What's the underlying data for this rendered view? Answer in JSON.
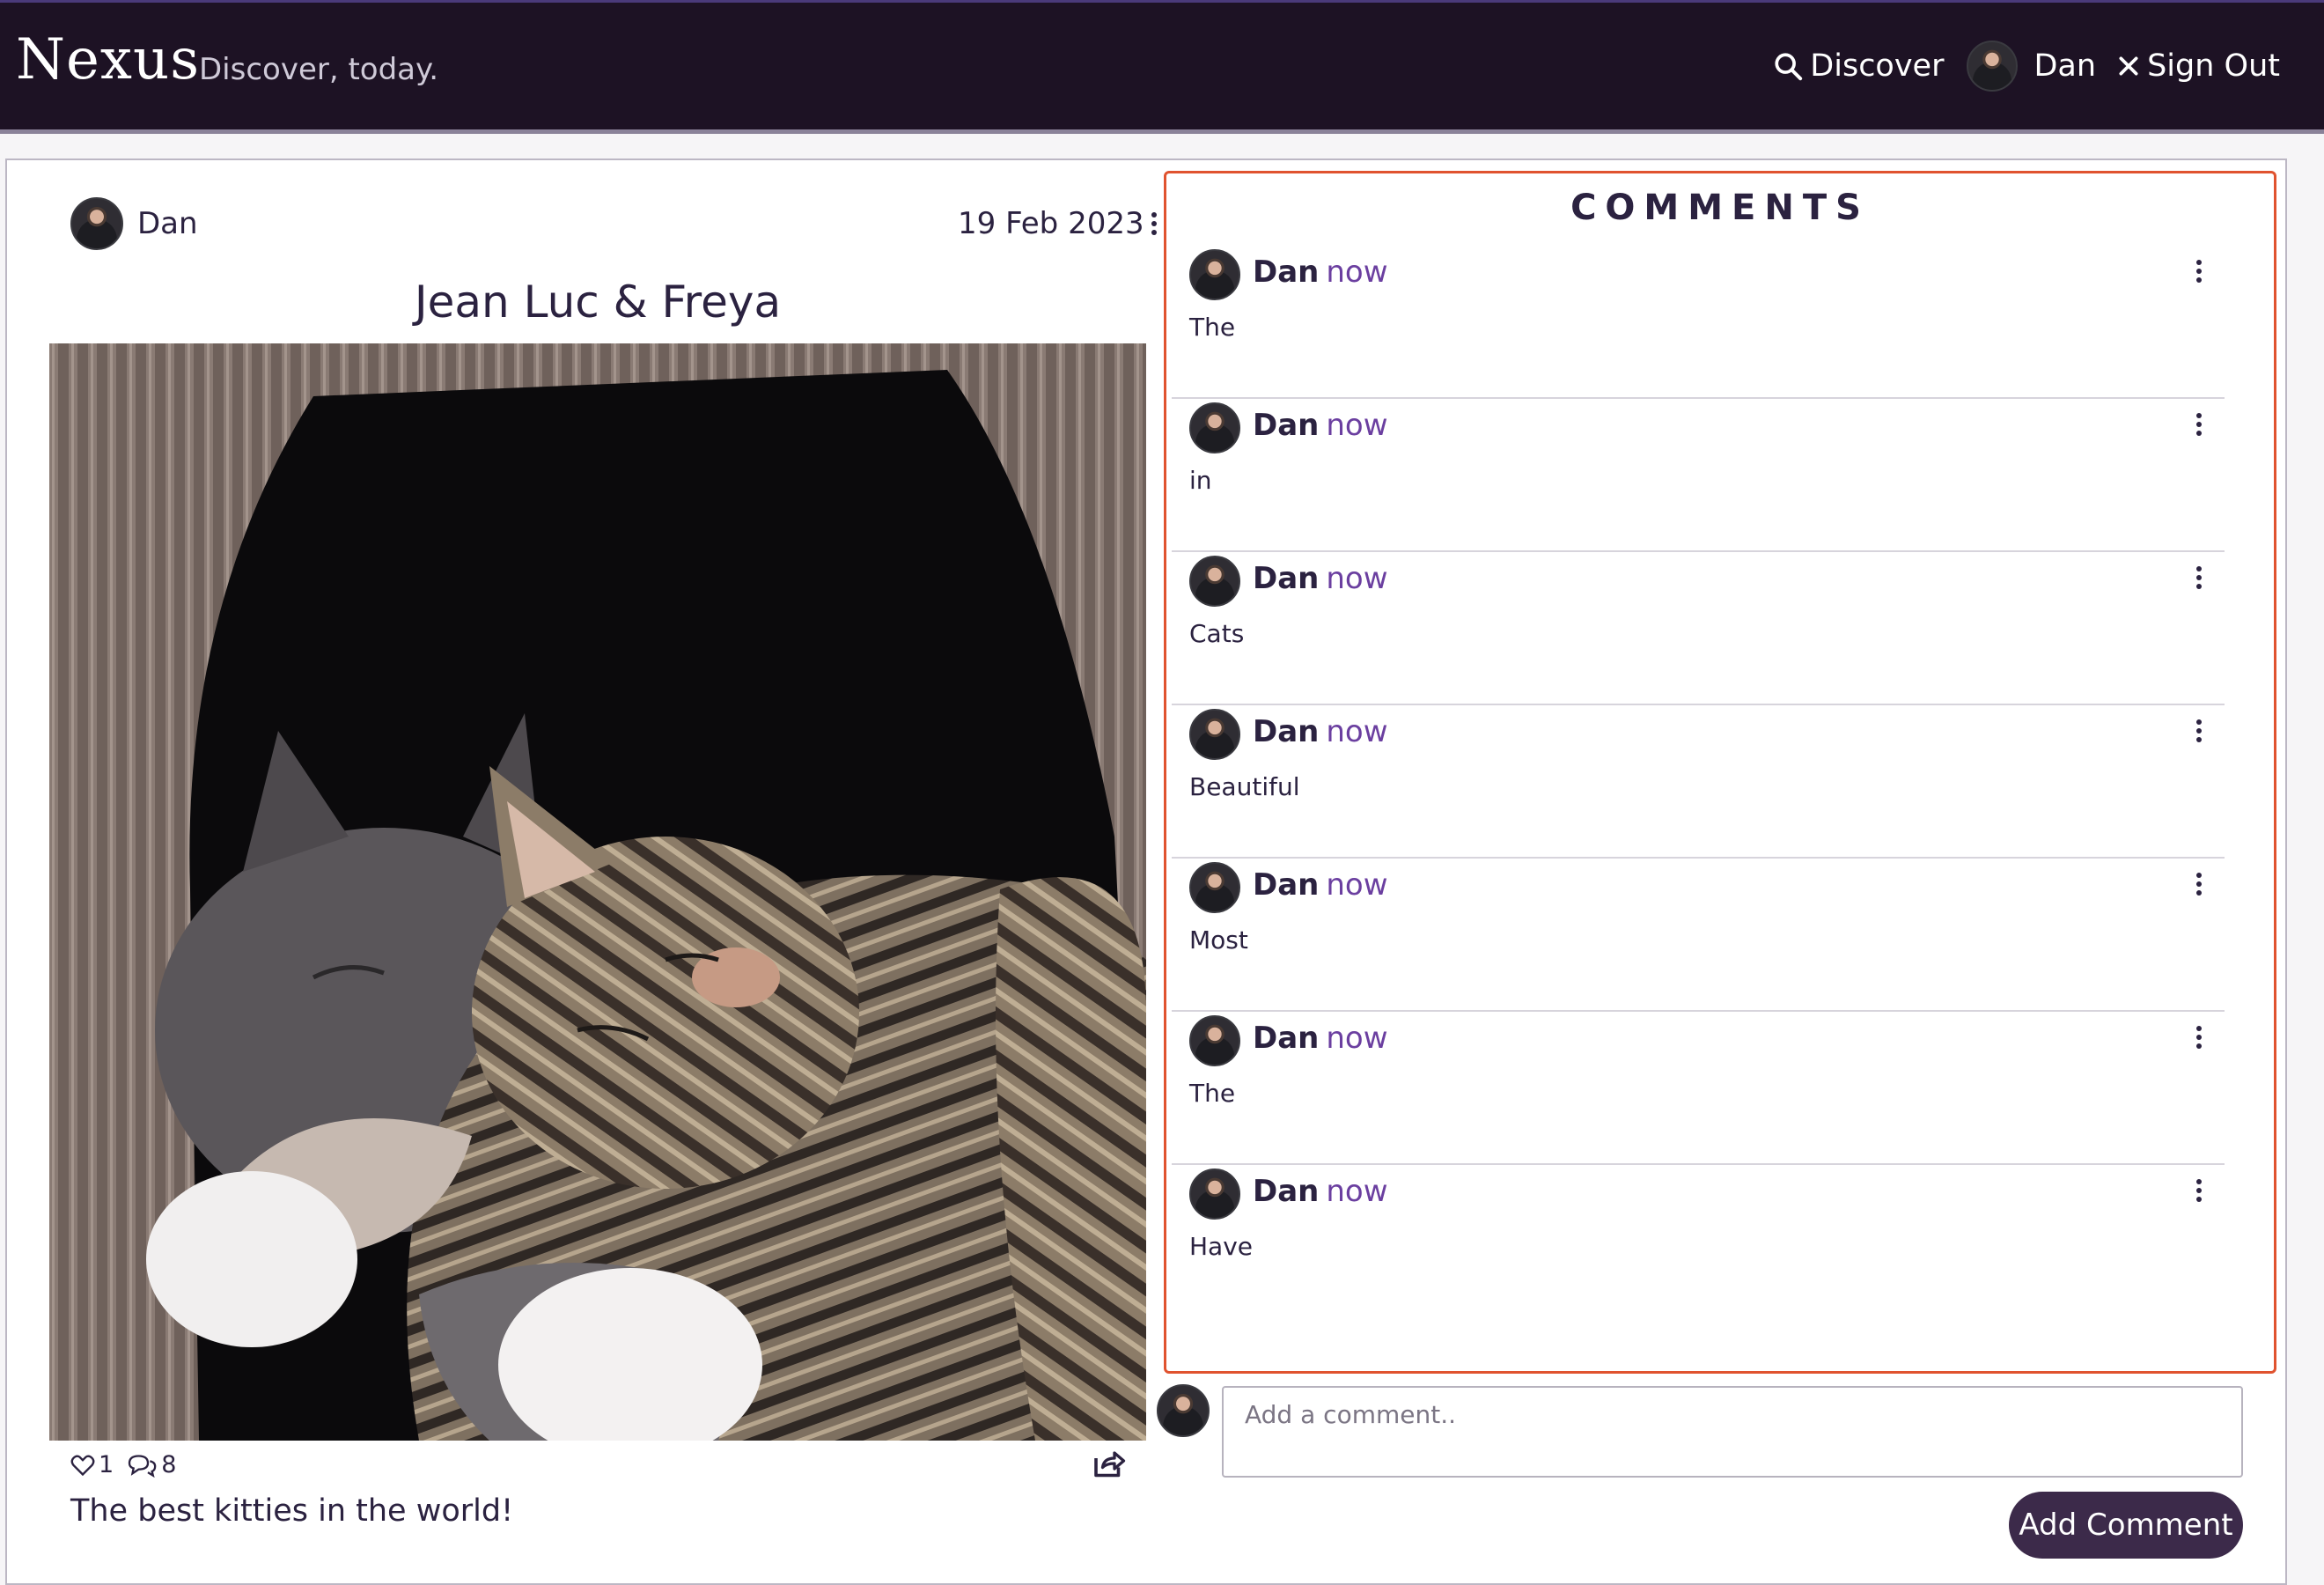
{
  "navbar": {
    "brand": "Nexus",
    "tagline": "Discover, today.",
    "discover_label": "Discover",
    "user_name": "Dan",
    "signout_label": "Sign Out"
  },
  "post": {
    "author": "Dan",
    "date": "19 Feb 2023",
    "title": "Jean Luc & Freya",
    "likes": "1",
    "comments_count": "8",
    "caption": "The best kitties in the world!"
  },
  "comments": {
    "title": "COMMENTS",
    "items": [
      {
        "author": "Dan",
        "time": "now",
        "body": "The"
      },
      {
        "author": "Dan",
        "time": "now",
        "body": "in"
      },
      {
        "author": "Dan",
        "time": "now",
        "body": "Cats"
      },
      {
        "author": "Dan",
        "time": "now",
        "body": "Beautiful"
      },
      {
        "author": "Dan",
        "time": "now",
        "body": "Most"
      },
      {
        "author": "Dan",
        "time": "now",
        "body": "The"
      },
      {
        "author": "Dan",
        "time": "now",
        "body": "Have"
      }
    ]
  },
  "add_comment": {
    "placeholder": "Add a comment..",
    "button_label": "Add Comment"
  },
  "colors": {
    "navbar_bg": "#1d1224",
    "accent": "#6b3fa0",
    "highlight_border": "#e0532f",
    "button_bg": "#3c2a4a"
  }
}
